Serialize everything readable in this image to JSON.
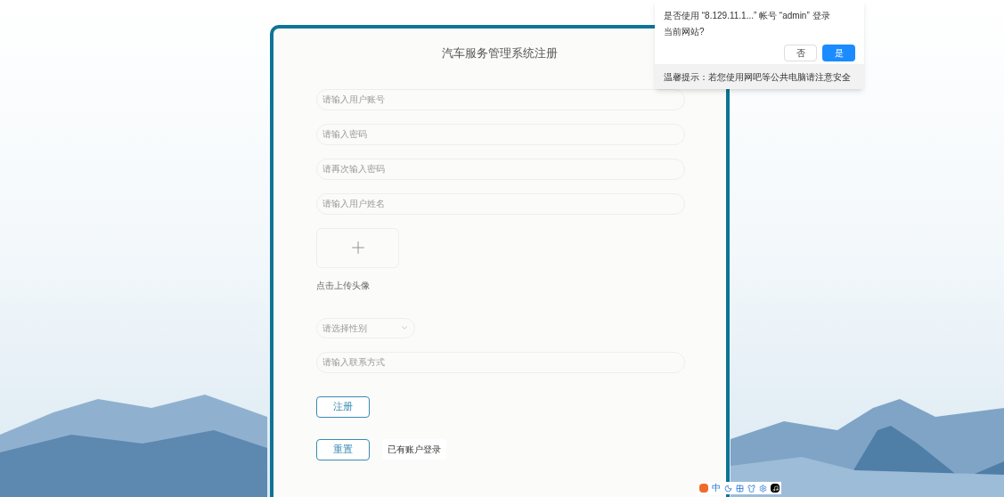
{
  "register_form": {
    "title": "汽车服务管理系统注册",
    "fields": [
      {
        "kind": "input",
        "placeholder": "请输入用户账号"
      },
      {
        "kind": "input",
        "placeholder": "请输入密码"
      },
      {
        "kind": "input",
        "placeholder": "请再次输入密码"
      },
      {
        "kind": "input",
        "placeholder": "请输入用户姓名"
      },
      {
        "kind": "upload",
        "label": "点击上传头像"
      },
      {
        "kind": "select",
        "placeholder": "请选择性别"
      },
      {
        "kind": "input",
        "placeholder": "请输入联系方式"
      }
    ],
    "register_button": "注册",
    "reset_button": "重置",
    "login_link": "已有账户登录"
  },
  "password_prompt": {
    "message": "是否使用 “8.129.11.1...” 帐号 “admin” 登录",
    "message_line_2": "当前网站?",
    "buttons": [
      {
        "label": "否",
        "primary": false
      },
      {
        "label": "是",
        "primary": true
      }
    ],
    "hint": "温馨提示：若您使用网吧等公共电脑请注意安全"
  },
  "ime_toolbar": {
    "mode": "中"
  }
}
